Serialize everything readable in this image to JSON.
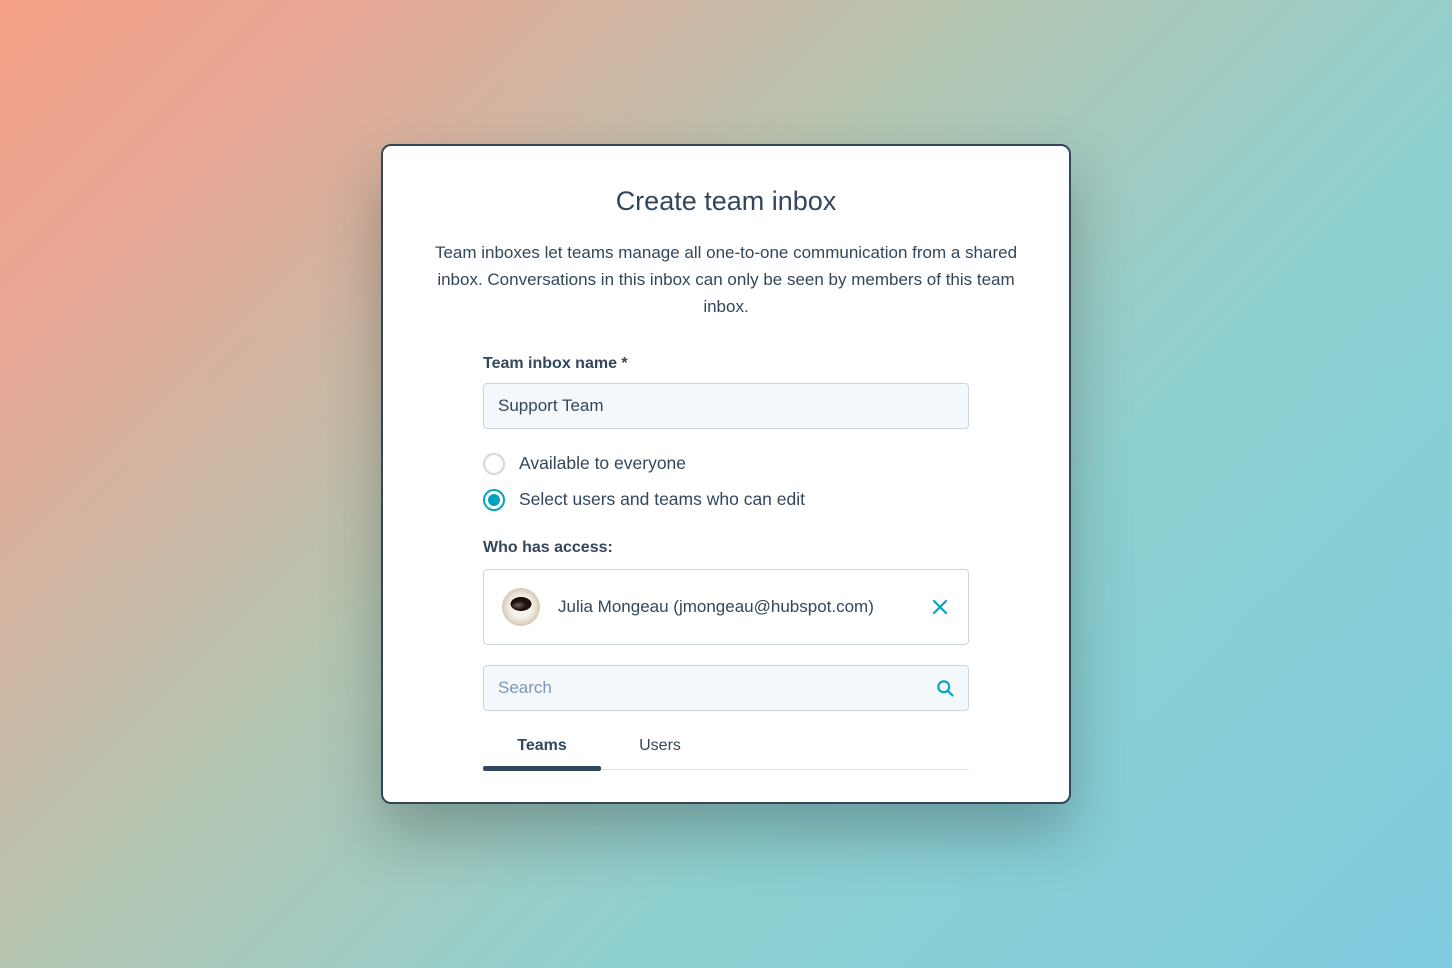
{
  "modal": {
    "title": "Create team inbox",
    "description": "Team inboxes let teams manage all one-to-one communication from a shared inbox. Conversations in this inbox can only be seen by members of this team inbox."
  },
  "form": {
    "name_label": "Team inbox name *",
    "name_value": "Support Team",
    "radio_everyone": "Available to everyone",
    "radio_select": "Select users and teams who can edit",
    "access_label": "Who has access:"
  },
  "user": {
    "display": "Julia Mongeau (jmongeau@hubspot.com)"
  },
  "search": {
    "placeholder": "Search"
  },
  "tabs": {
    "teams": "Teams",
    "users": "Users"
  }
}
